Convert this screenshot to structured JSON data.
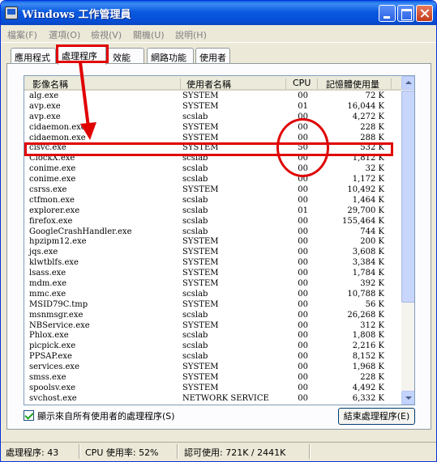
{
  "window": {
    "title": "Windows 工作管理員",
    "accent_color": "#0a5ae0"
  },
  "menu": {
    "items": [
      "檔案(F)",
      "選項(O)",
      "檢視(V)",
      "關機(U)",
      "說明(H)"
    ]
  },
  "tabs": [
    {
      "label": "應用程式",
      "active": false
    },
    {
      "label": "處理程序",
      "active": true
    },
    {
      "label": "效能",
      "active": false
    },
    {
      "label": "網路功能",
      "active": false
    },
    {
      "label": "使用者",
      "active": false
    }
  ],
  "table": {
    "headers": {
      "name": "影像名稱",
      "user": "使用者名稱",
      "cpu": "CPU",
      "mem": "記憶體使用量"
    },
    "rows": [
      {
        "name": "alg.exe",
        "user": "SYSTEM",
        "cpu": "00",
        "mem": "72 K"
      },
      {
        "name": "avp.exe",
        "user": "SYSTEM",
        "cpu": "01",
        "mem": "16,044 K"
      },
      {
        "name": "avp.exe",
        "user": "scslab",
        "cpu": "00",
        "mem": "4,272 K"
      },
      {
        "name": "cidaemon.exe",
        "user": "SYSTEM",
        "cpu": "00",
        "mem": "228 K"
      },
      {
        "name": "cidaemon.exe",
        "user": "SYSTEM",
        "cpu": "00",
        "mem": "288 K"
      },
      {
        "name": "cisvc.exe",
        "user": "SYSTEM",
        "cpu": "50",
        "mem": "532 K"
      },
      {
        "name": "ClockX.exe",
        "user": "scslab",
        "cpu": "00",
        "mem": "1,812 K"
      },
      {
        "name": "conime.exe",
        "user": "scslab",
        "cpu": "00",
        "mem": "32 K"
      },
      {
        "name": "conime.exe",
        "user": "scslab",
        "cpu": "00",
        "mem": "1,172 K"
      },
      {
        "name": "csrss.exe",
        "user": "SYSTEM",
        "cpu": "00",
        "mem": "10,492 K"
      },
      {
        "name": "ctfmon.exe",
        "user": "scslab",
        "cpu": "00",
        "mem": "1,464 K"
      },
      {
        "name": "explorer.exe",
        "user": "scslab",
        "cpu": "01",
        "mem": "29,700 K"
      },
      {
        "name": "firefox.exe",
        "user": "scslab",
        "cpu": "00",
        "mem": "155,464 K"
      },
      {
        "name": "GoogleCrashHandler.exe",
        "user": "scslab",
        "cpu": "00",
        "mem": "744 K"
      },
      {
        "name": "hpzipm12.exe",
        "user": "SYSTEM",
        "cpu": "00",
        "mem": "200 K"
      },
      {
        "name": "jqs.exe",
        "user": "SYSTEM",
        "cpu": "00",
        "mem": "3,608 K"
      },
      {
        "name": "klwtblfs.exe",
        "user": "SYSTEM",
        "cpu": "00",
        "mem": "3,384 K"
      },
      {
        "name": "lsass.exe",
        "user": "SYSTEM",
        "cpu": "00",
        "mem": "1,784 K"
      },
      {
        "name": "mdm.exe",
        "user": "SYSTEM",
        "cpu": "00",
        "mem": "392 K"
      },
      {
        "name": "mmc.exe",
        "user": "scslab",
        "cpu": "00",
        "mem": "10,788 K"
      },
      {
        "name": "MSID79C.tmp",
        "user": "SYSTEM",
        "cpu": "00",
        "mem": "56 K"
      },
      {
        "name": "msnmsgr.exe",
        "user": "scslab",
        "cpu": "00",
        "mem": "26,268 K"
      },
      {
        "name": "NBService.exe",
        "user": "SYSTEM",
        "cpu": "00",
        "mem": "312 K"
      },
      {
        "name": "Phlox.exe",
        "user": "scslab",
        "cpu": "00",
        "mem": "1,808 K"
      },
      {
        "name": "picpick.exe",
        "user": "scslab",
        "cpu": "00",
        "mem": "2,216 K"
      },
      {
        "name": "PPSAP.exe",
        "user": "scslab",
        "cpu": "00",
        "mem": "8,152 K"
      },
      {
        "name": "services.exe",
        "user": "SYSTEM",
        "cpu": "00",
        "mem": "1,968 K"
      },
      {
        "name": "smss.exe",
        "user": "SYSTEM",
        "cpu": "00",
        "mem": "228 K"
      },
      {
        "name": "spoolsv.exe",
        "user": "SYSTEM",
        "cpu": "00",
        "mem": "4,492 K"
      },
      {
        "name": "svchost.exe",
        "user": "NETWORK SERVICE",
        "cpu": "00",
        "mem": "6,332 K"
      }
    ]
  },
  "show_all_users": {
    "label": "顯示來自所有使用者的處理程序(S)",
    "checked": true
  },
  "end_process_label": "結束處理程序(E)",
  "status": {
    "processes": "處理程序: 43",
    "cpu": "CPU 使用率: 52%",
    "commit": "認可使用: 721K / 2441K"
  },
  "annotation_color": "#e00000"
}
